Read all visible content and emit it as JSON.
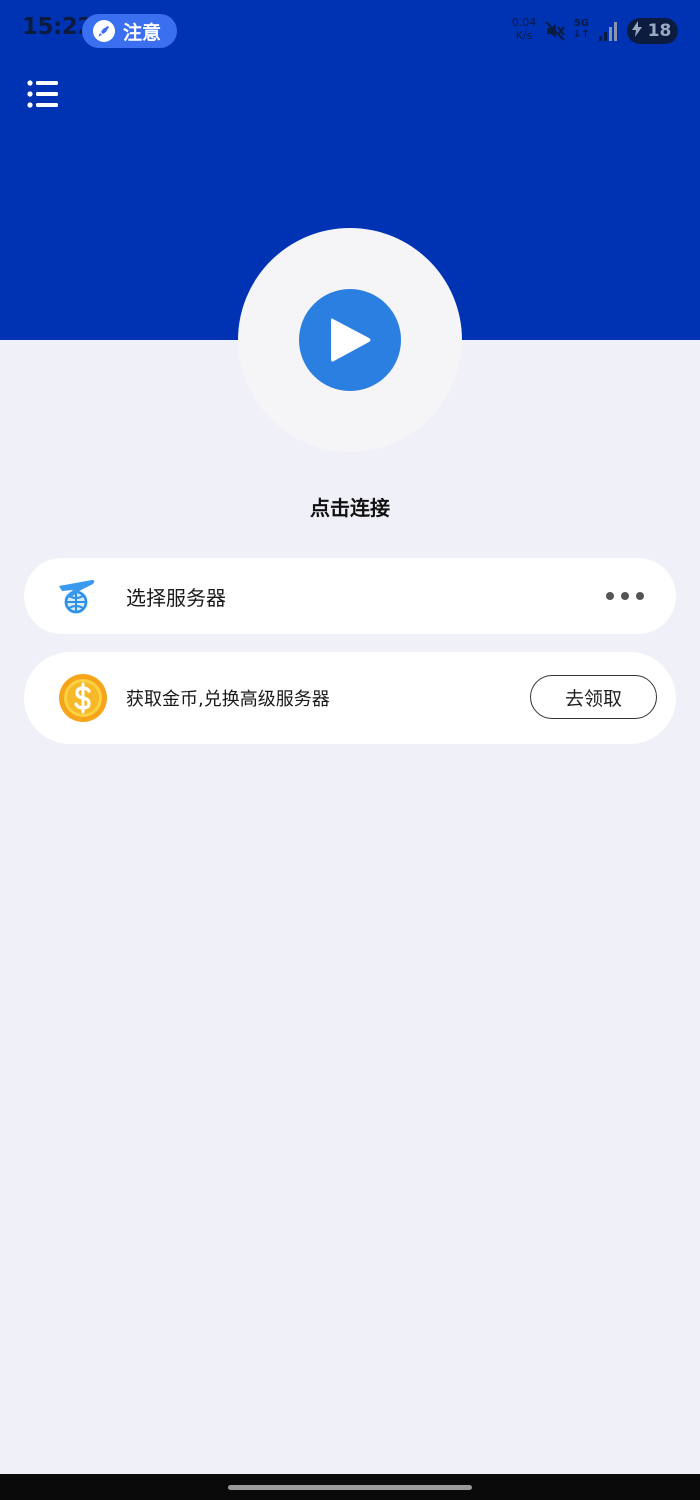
{
  "status_bar": {
    "time": "15:22",
    "notice_label": "注意",
    "net_speed_value": "0.04",
    "net_speed_unit": "K/s",
    "signal_label_top": "5G",
    "signal_label_bottom": "↓↑",
    "battery_level": "18"
  },
  "main": {
    "connect_label": "点击连接",
    "server_label": "选择服务器",
    "coin_label": "获取金币,兑换高级服务器",
    "claim_label": "去领取"
  },
  "colors": {
    "header": "#0033b3",
    "play_button": "#2a7fe0",
    "background": "#eff0f8",
    "notice_pill": "#3a6ff0"
  },
  "icons": {
    "menu": "list-menu-icon",
    "play": "play-icon",
    "server": "plane-globe-icon",
    "more": "more-dots-icon",
    "coin": "dollar-coin-icon",
    "notice": "rocket-icon",
    "mute": "mute-icon",
    "signal": "signal-bars-icon",
    "battery": "battery-charging-icon"
  }
}
